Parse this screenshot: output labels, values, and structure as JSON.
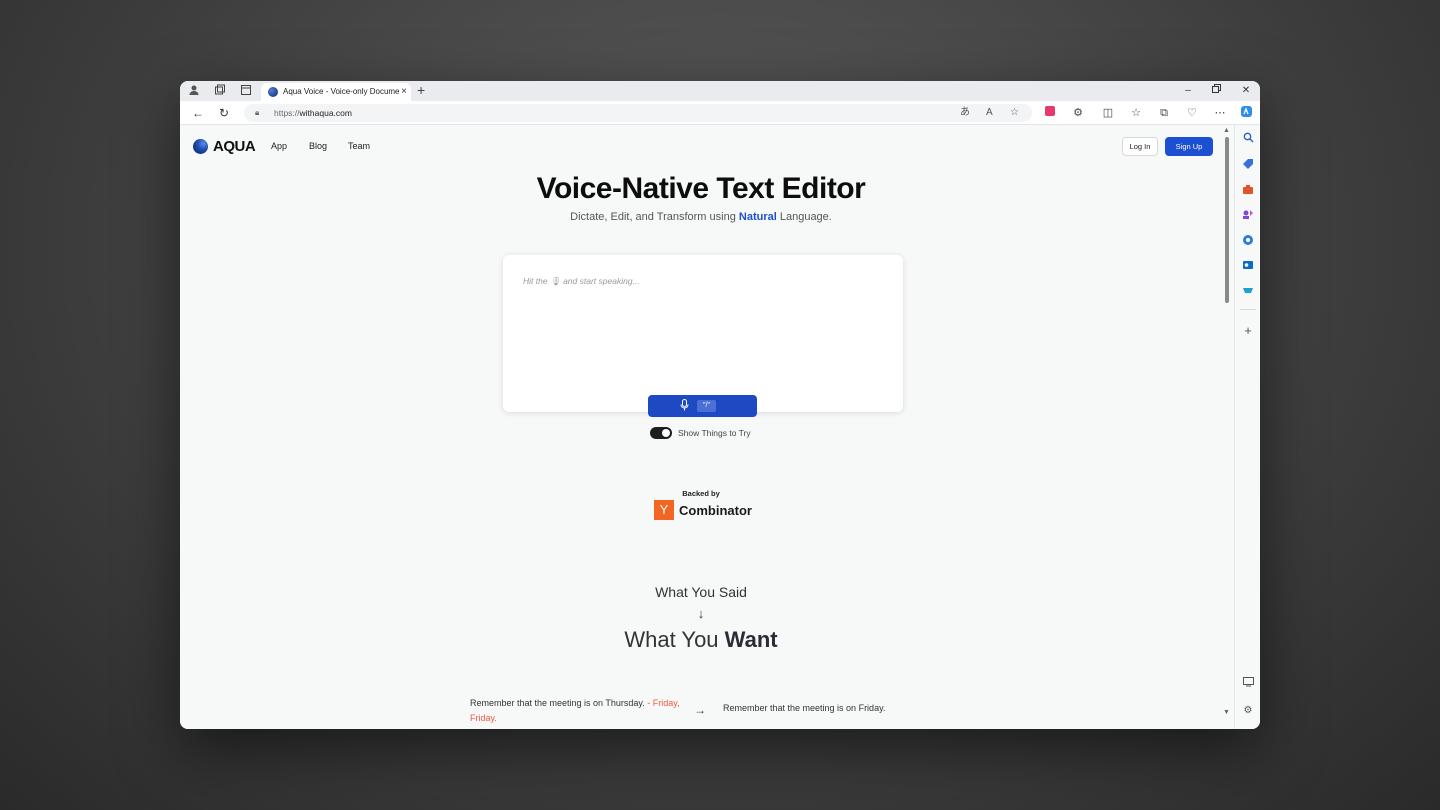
{
  "browser": {
    "tab_title": "Aqua Voice - Voice-only Docume",
    "url_proto": "https://",
    "url_host": "withaqua.com",
    "new_tab": "+",
    "tab_close": "×"
  },
  "nav": {
    "logo_text": "AQUA",
    "links": [
      "App",
      "Blog",
      "Team"
    ],
    "login": "Log In",
    "signup": "Sign Up"
  },
  "hero": {
    "title": "Voice-Native Text Editor",
    "subtitle_pre": "Dictate, Edit, and Transform using ",
    "subtitle_highlight": "Natural",
    "subtitle_post": " Language."
  },
  "editor": {
    "placeholder": "Hit the 🎙 and start speaking...",
    "shortcut": "\"/\""
  },
  "toggle": {
    "label": "Show Things to Try",
    "state": "on"
  },
  "backing": {
    "label": "Backed by",
    "yc_letter": "Y",
    "yc_name": "Combinator"
  },
  "section": {
    "said": "What You Said",
    "arrow": "↓",
    "want_pre": "What You ",
    "want_bold": "Want"
  },
  "example": {
    "input_text": "Remember that the meeting is on Thursday.",
    "input_correction": " - Friday, Friday.",
    "arrow": "→",
    "output_text": "Remember that the meeting is on Friday."
  },
  "colors": {
    "accent": "#1c4fd1",
    "yc_orange": "#f26522",
    "correction_red": "#f0593e"
  }
}
